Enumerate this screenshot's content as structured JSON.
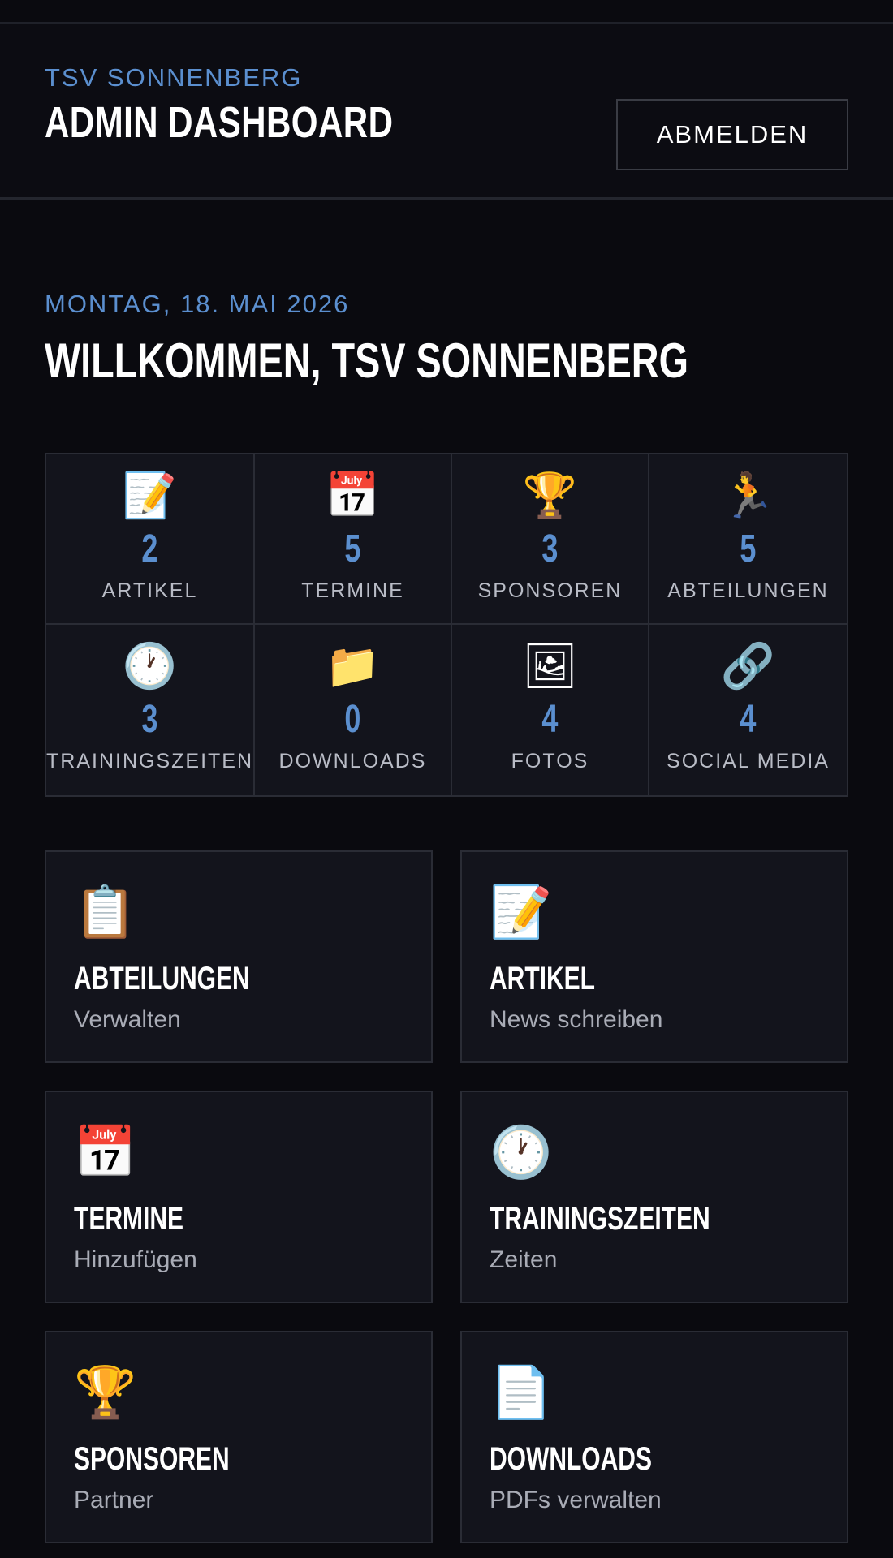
{
  "header": {
    "club": "TSV SONNENBERG",
    "title": "ADMIN DASHBOARD",
    "logout_label": "ABMELDEN"
  },
  "welcome": {
    "date": "MONTAG, 18. MAI 2026",
    "greeting": "WILLKOMMEN, TSV SONNENBERG"
  },
  "stats": [
    {
      "icon": "📝",
      "icon_name": "memo-icon",
      "value": "2",
      "label": "ARTIKEL"
    },
    {
      "icon": "📅",
      "icon_name": "calendar-icon",
      "value": "5",
      "label": "TERMINE"
    },
    {
      "icon": "🏆",
      "icon_name": "trophy-icon",
      "value": "3",
      "label": "SPONSOREN"
    },
    {
      "icon": "🏃",
      "icon_name": "runner-icon",
      "value": "5",
      "label": "ABTEILUNGEN"
    },
    {
      "icon": "🕐",
      "icon_name": "clock-icon",
      "value": "3",
      "label": "TRAININGSZEITEN"
    },
    {
      "icon": "📁",
      "icon_name": "folder-icon",
      "value": "0",
      "label": "DOWNLOADS"
    },
    {
      "icon": "🖼",
      "icon_name": "picture-icon",
      "value": "4",
      "label": "FOTOS"
    },
    {
      "icon": "🔗",
      "icon_name": "link-icon",
      "value": "4",
      "label": "SOCIAL MEDIA"
    }
  ],
  "cards": [
    {
      "icon": "📋",
      "icon_name": "clipboard-icon",
      "title": "ABTEILUNGEN",
      "subtitle": "Verwalten"
    },
    {
      "icon": "📝",
      "icon_name": "memo-icon",
      "title": "ARTIKEL",
      "subtitle": "News schreiben"
    },
    {
      "icon": "📅",
      "icon_name": "calendar-icon",
      "title": "TERMINE",
      "subtitle": "Hinzufügen"
    },
    {
      "icon": "🕐",
      "icon_name": "clock-icon",
      "title": "TRAININGSZEITEN",
      "subtitle": "Zeiten"
    },
    {
      "icon": "🏆",
      "icon_name": "trophy-icon",
      "title": "SPONSOREN",
      "subtitle": "Partner"
    },
    {
      "icon": "📄",
      "icon_name": "document-icon",
      "title": "DOWNLOADS",
      "subtitle": "PDFs verwalten"
    }
  ],
  "colors": {
    "background": "#0a0a0f",
    "panel": "#13141c",
    "accent": "#5b8fcf",
    "border": "#2a2c35"
  }
}
